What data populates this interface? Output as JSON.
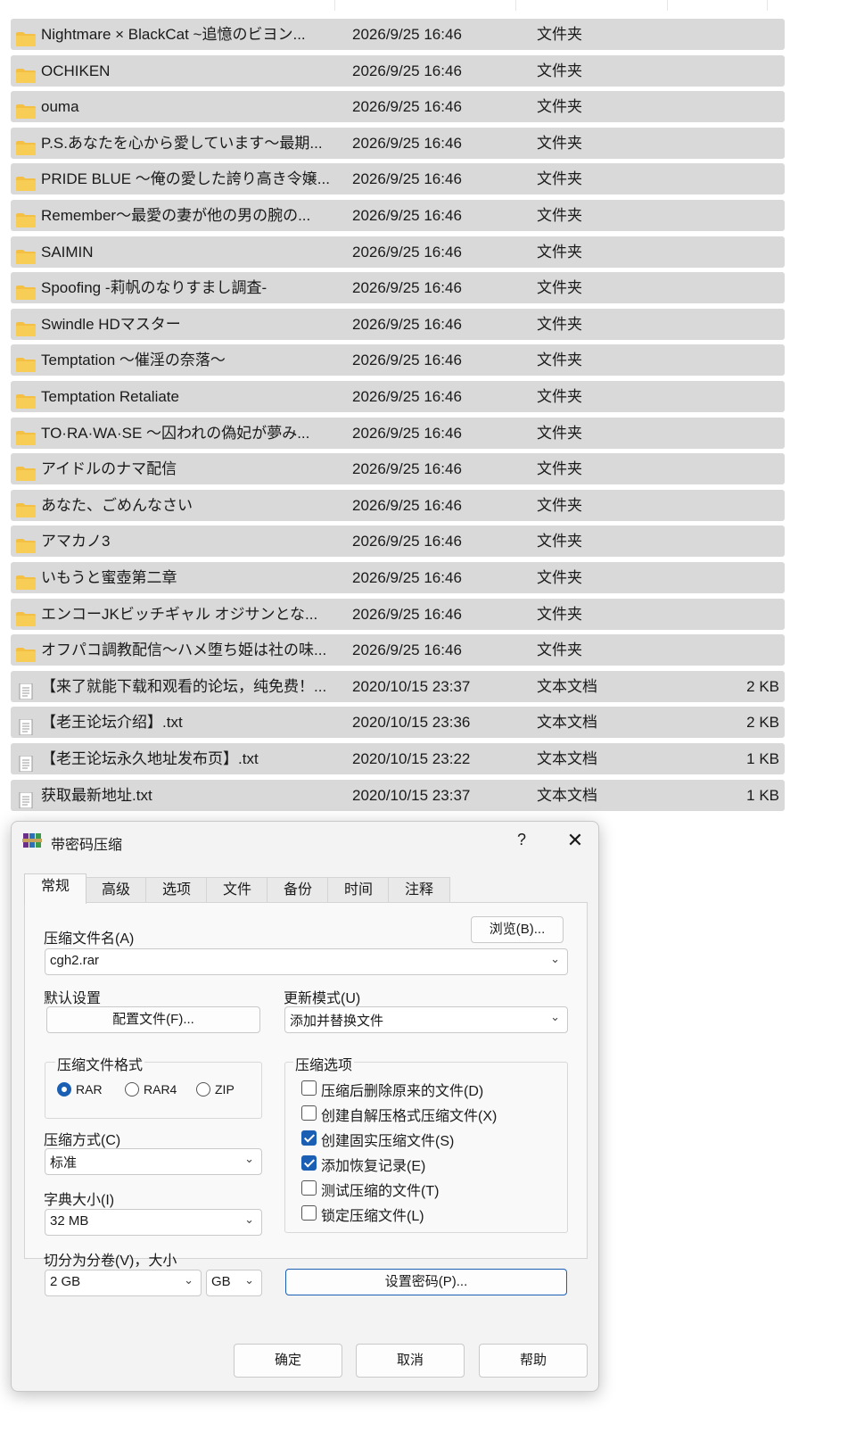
{
  "files": [
    {
      "name": "Nightmare × BlackCat ~追憶のビヨン...",
      "date": "2026/9/25 16:46",
      "type": "文件夹",
      "size": "",
      "icon": "folder-icon"
    },
    {
      "name": "OCHIKEN",
      "date": "2026/9/25 16:46",
      "type": "文件夹",
      "size": "",
      "icon": "folder-icon"
    },
    {
      "name": "ouma",
      "date": "2026/9/25 16:46",
      "type": "文件夹",
      "size": "",
      "icon": "folder-icon"
    },
    {
      "name": "P.S.あなたを心から愛しています～最期...",
      "date": "2026/9/25 16:46",
      "type": "文件夹",
      "size": "",
      "icon": "folder-icon"
    },
    {
      "name": "PRIDE BLUE ～俺の愛した誇り高き令嬢...",
      "date": "2026/9/25 16:46",
      "type": "文件夹",
      "size": "",
      "icon": "folder-icon"
    },
    {
      "name": "Remember～最愛の妻が他の男の腕の...",
      "date": "2026/9/25 16:46",
      "type": "文件夹",
      "size": "",
      "icon": "folder-icon"
    },
    {
      "name": "SAIMIN",
      "date": "2026/9/25 16:46",
      "type": "文件夹",
      "size": "",
      "icon": "folder-icon"
    },
    {
      "name": "Spoofing -莉帆のなりすまし調査-",
      "date": "2026/9/25 16:46",
      "type": "文件夹",
      "size": "",
      "icon": "folder-icon"
    },
    {
      "name": "Swindle HDマスター",
      "date": "2026/9/25 16:46",
      "type": "文件夹",
      "size": "",
      "icon": "folder-icon"
    },
    {
      "name": "Temptation ～催淫の奈落～",
      "date": "2026/9/25 16:46",
      "type": "文件夹",
      "size": "",
      "icon": "folder-icon"
    },
    {
      "name": "Temptation Retaliate",
      "date": "2026/9/25 16:46",
      "type": "文件夹",
      "size": "",
      "icon": "folder-icon"
    },
    {
      "name": "TO·RA·WA·SE ～囚われの偽妃が夢み...",
      "date": "2026/9/25 16:46",
      "type": "文件夹",
      "size": "",
      "icon": "folder-icon"
    },
    {
      "name": "アイドルのナマ配信",
      "date": "2026/9/25 16:46",
      "type": "文件夹",
      "size": "",
      "icon": "folder-icon"
    },
    {
      "name": "あなた、ごめんなさい",
      "date": "2026/9/25 16:46",
      "type": "文件夹",
      "size": "",
      "icon": "folder-icon"
    },
    {
      "name": "アマカノ3",
      "date": "2026/9/25 16:46",
      "type": "文件夹",
      "size": "",
      "icon": "folder-icon"
    },
    {
      "name": "いもうと蜜壺第二章",
      "date": "2026/9/25 16:46",
      "type": "文件夹",
      "size": "",
      "icon": "folder-icon"
    },
    {
      "name": "エンコーJKビッチギャル オジサンとな...",
      "date": "2026/9/25 16:46",
      "type": "文件夹",
      "size": "",
      "icon": "folder-icon"
    },
    {
      "name": "オフパコ調教配信～ハメ堕ち姫は社の味...",
      "date": "2026/9/25 16:46",
      "type": "文件夹",
      "size": "",
      "icon": "folder-icon"
    },
    {
      "name": "【来了就能下载和观看的论坛，纯免费！...",
      "date": "2020/10/15 23:37",
      "type": "文本文档",
      "size": "2 KB",
      "icon": "text-file-icon"
    },
    {
      "name": "【老王论坛介绍】.txt",
      "date": "2020/10/15 23:36",
      "type": "文本文档",
      "size": "2 KB",
      "icon": "text-file-icon"
    },
    {
      "name": "【老王论坛永久地址发布页】.txt",
      "date": "2020/10/15 23:22",
      "type": "文本文档",
      "size": "1 KB",
      "icon": "text-file-icon"
    },
    {
      "name": "获取最新地址.txt",
      "date": "2020/10/15 23:37",
      "type": "文本文档",
      "size": "1 KB",
      "icon": "text-file-icon"
    }
  ],
  "dialog": {
    "title": "带密码压缩",
    "help_label": "?",
    "close_label": "✕",
    "tabs": [
      {
        "label": "常规",
        "active": true
      },
      {
        "label": "高级",
        "active": false
      },
      {
        "label": "选项",
        "active": false
      },
      {
        "label": "文件",
        "active": false
      },
      {
        "label": "备份",
        "active": false
      },
      {
        "label": "时间",
        "active": false
      },
      {
        "label": "注释",
        "active": false
      }
    ],
    "archive_name_label": "压缩文件名(A)",
    "browse_label": "浏览(B)...",
    "archive_name_value": "cgh2.rar",
    "default_settings_label": "默认设置",
    "profiles_label": "配置文件(F)...",
    "update_mode_label": "更新模式(U)",
    "update_mode_value": "添加并替换文件",
    "format_group_label": "压缩文件格式",
    "formats": [
      {
        "label": "RAR",
        "checked": true
      },
      {
        "label": "RAR4",
        "checked": false
      },
      {
        "label": "ZIP",
        "checked": false
      }
    ],
    "method_label": "压缩方式(C)",
    "method_value": "标准",
    "dict_label": "字典大小(I)",
    "dict_value": "32 MB",
    "split_label": "切分为分卷(V)，大小",
    "split_value": "2 GB",
    "split_unit": "GB",
    "options_group_label": "压缩选项",
    "options": [
      {
        "label": "压缩后删除原来的文件(D)",
        "checked": false
      },
      {
        "label": "创建自解压格式压缩文件(X)",
        "checked": false
      },
      {
        "label": "创建固实压缩文件(S)",
        "checked": true
      },
      {
        "label": "添加恢复记录(E)",
        "checked": true
      },
      {
        "label": "测试压缩的文件(T)",
        "checked": false
      },
      {
        "label": "锁定压缩文件(L)",
        "checked": false
      }
    ],
    "set_password_label": "设置密码(P)...",
    "ok_label": "确定",
    "cancel_label": "取消",
    "help_button_label": "帮助",
    "chevron_icon": "chevron-down-icon",
    "accent_color": "#1a5fb4"
  },
  "colors": {
    "row_background": "#d9d9d9",
    "folder_yellow": "#f4c043",
    "dialog_background": "#f3f3f3"
  }
}
